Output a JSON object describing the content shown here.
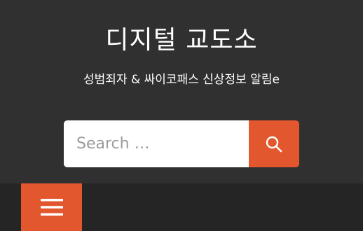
{
  "header": {
    "site_title": "디지털 교도소",
    "tagline": "성범죄자 & 싸이코패스 신상정보 알림e"
  },
  "search": {
    "placeholder": "Search …",
    "value": "",
    "button_icon": "search-icon"
  },
  "nav": {
    "menu_icon": "hamburger-menu-icon"
  },
  "colors": {
    "background": "#303030",
    "nav_background": "#252525",
    "accent": "#e3572f",
    "text": "#ffffff"
  }
}
